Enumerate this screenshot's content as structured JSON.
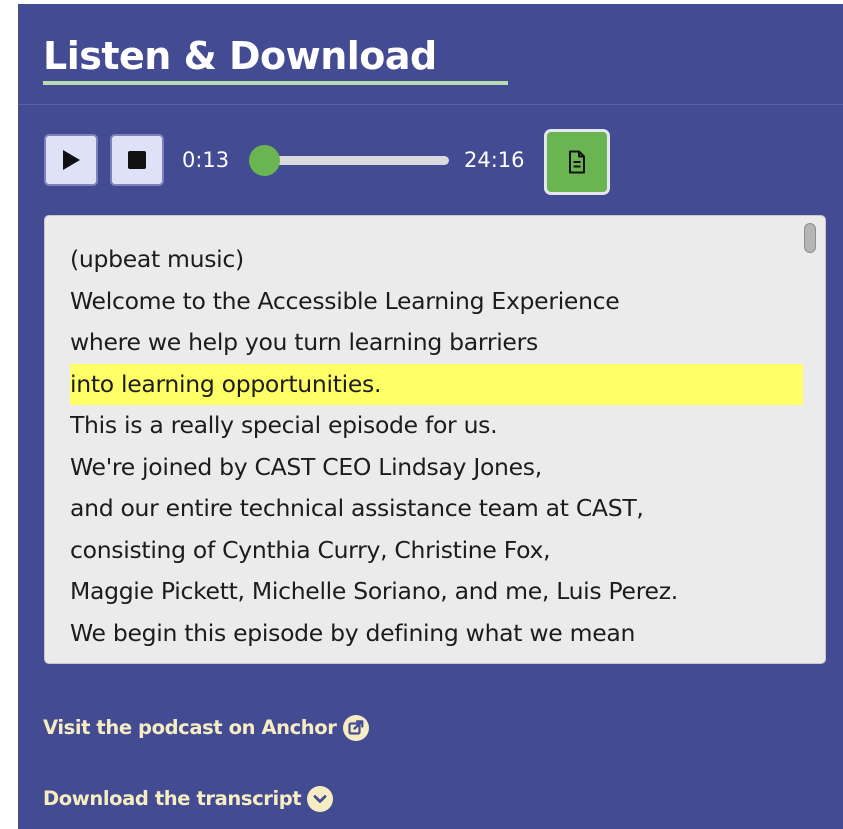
{
  "section": {
    "title": "Listen & Download"
  },
  "player": {
    "current_time": "0:13",
    "total_time": "24:16",
    "progress": 0.009,
    "play_icon": "play-icon",
    "stop_icon": "stop-icon",
    "transcript_icon": "document-icon"
  },
  "transcript": {
    "highlighted_line_index": 3,
    "lines": [
      "(upbeat music)",
      "Welcome to the Accessible Learning Experience",
      "where we help you turn learning barriers",
      "into learning opportunities.",
      "This is a really special episode for us.",
      "We're joined by CAST CEO Lindsay Jones,",
      "and our entire technical assistance team at CAST,",
      "consisting of Cynthia Curry, Christine Fox,",
      "Maggie Pickett, Michelle Soriano, and me, Luis Perez.",
      "We begin this episode by defining what we mean"
    ]
  },
  "links": {
    "anchor_label": "Visit the podcast on Anchor",
    "anchor_icon": "external-link-icon",
    "download_label": "Download the transcript",
    "download_icon": "chevron-down-icon"
  },
  "colors": {
    "panel_background": "#434b93",
    "accent_green": "#6ab451",
    "highlight": "#ffff66",
    "link_text": "#f6eec2",
    "title_underline": "#b9ddb0"
  }
}
